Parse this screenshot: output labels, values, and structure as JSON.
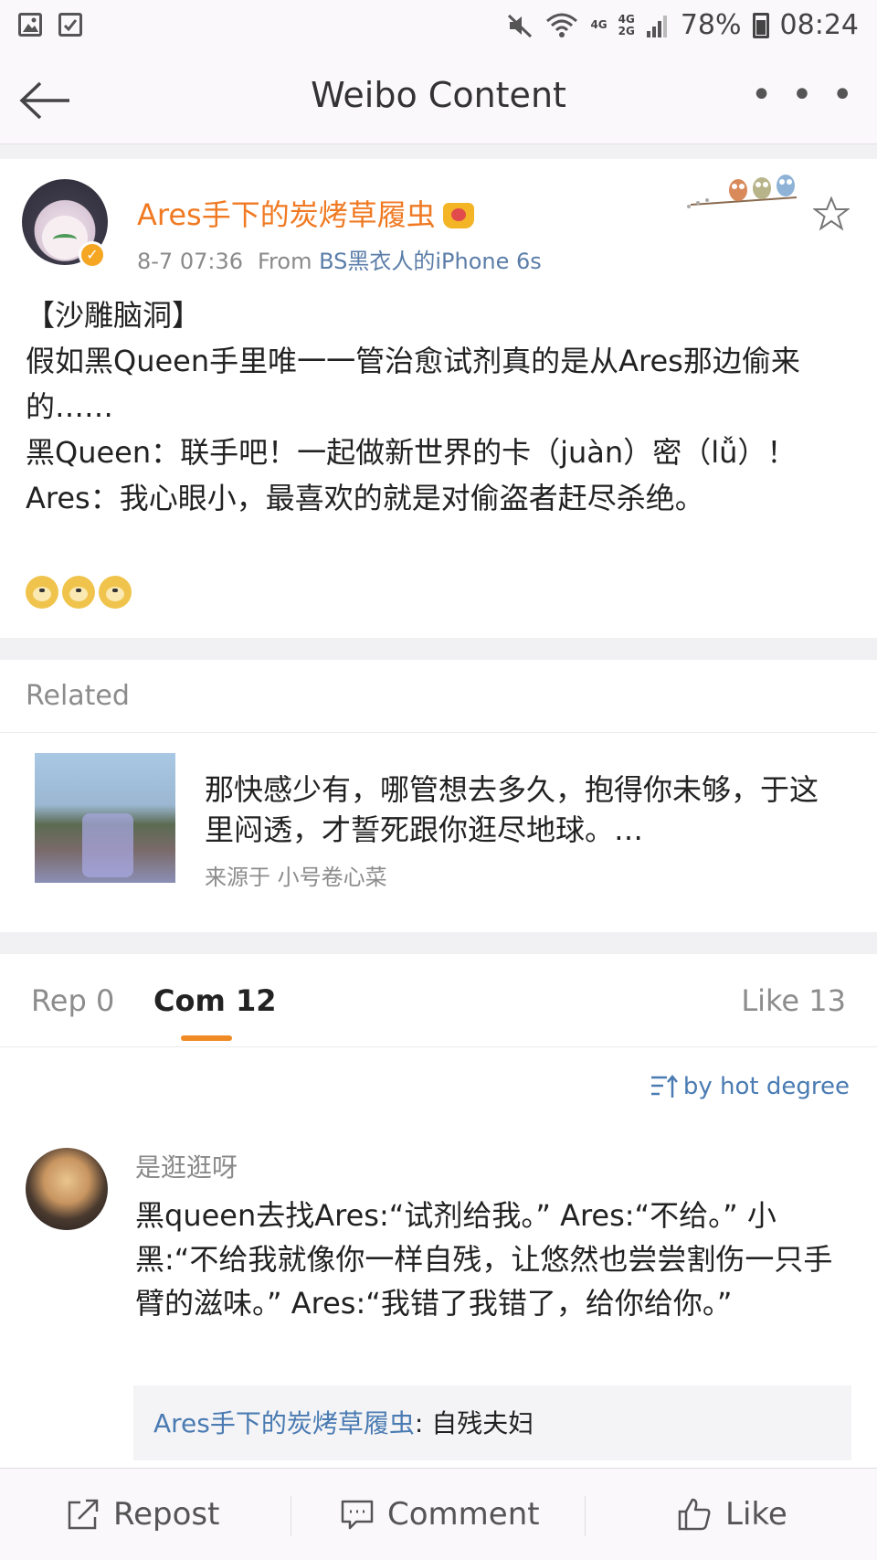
{
  "status_bar": {
    "network_top": "4G",
    "network_mid_top": "4G",
    "network_mid_bottom": "2G",
    "battery": "78%",
    "time": "08:24"
  },
  "nav": {
    "title": "Weibo Content",
    "more": "• • •"
  },
  "post": {
    "author": "Ares手下的炭烤草履虫",
    "time": "8-7 07:36",
    "from_prefix": "From",
    "source": "BS黑衣人的iPhone 6s",
    "verified_mark": "✓",
    "lines": [
      "【沙雕脑洞】",
      "假如黑Queen手里唯一一管治愈试剂真的是从Ares那边偷来的……",
      "黑Queen：联手吧！一起做新世界的卡（juàn）密（lǚ）！",
      "Ares：我心眼小，最喜欢的就是对偷盗者赶尽杀绝。"
    ]
  },
  "related": {
    "label": "Related",
    "text": "那快感少有，哪管想去多久，抱得你未够，于这里闷透，才誓死跟你逛尽地球。…",
    "source": "来源于 小号卷心菜"
  },
  "tabs": {
    "repost": "Rep 0",
    "comment": "Com 12",
    "like": "Like 13"
  },
  "sort": {
    "label": "by hot degree"
  },
  "comment": {
    "user": "是逛逛呀",
    "text": "黑queen去找Ares:“试剂给我。” Ares:“不给。” 小黑:“不给我就像你一样自残，让悠然也尝尝割伤一只手臂的滋味。” Ares:“我错了我错了，给你给你。”",
    "reply_user": "Ares手下的炭烤草履虫",
    "reply_text": ": 自残夫妇"
  },
  "bottom_bar": {
    "repost": "Repost",
    "comment": "Comment",
    "like": "Like"
  }
}
